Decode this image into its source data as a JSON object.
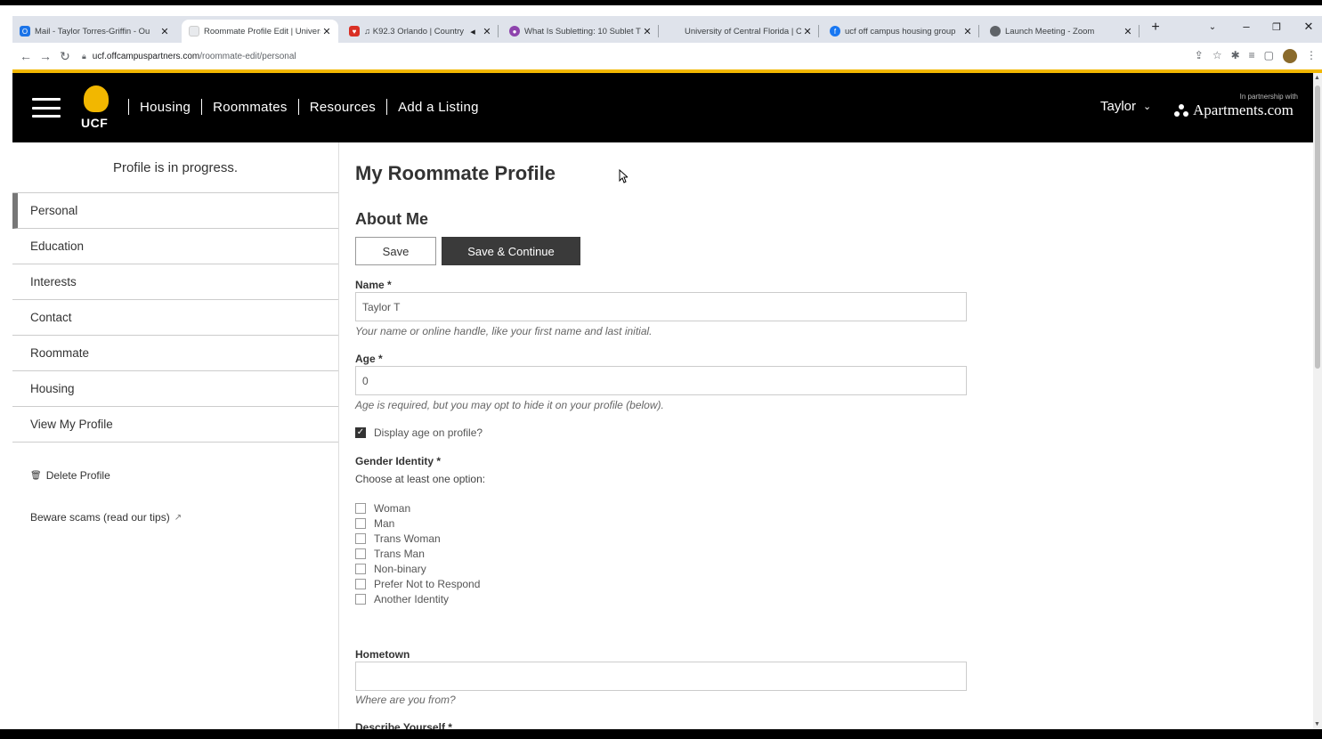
{
  "browser": {
    "tabs": [
      {
        "title": "Mail - Taylor Torres-Griffin - Ou",
        "active": false,
        "favicon_color": "#1a73e8"
      },
      {
        "title": "Roommate Profile Edit | Univers",
        "active": true,
        "favicon_color": "#cccccc"
      },
      {
        "title": "♫ K92.3 Orlando | Country",
        "active": false,
        "favicon_color": "#d93025"
      },
      {
        "title": "What Is Subletting: 10 Sublet T",
        "active": false,
        "favicon_color": "#8e44ad"
      },
      {
        "title": "University of Central Florida | C",
        "active": false,
        "favicon_color": "#dfe3eb"
      },
      {
        "title": "ucf off campus housing group",
        "active": false,
        "favicon_color": "#1877f2"
      },
      {
        "title": "Launch Meeting - Zoom",
        "active": false,
        "favicon_color": "#5f6368"
      }
    ],
    "new_tab_label": "+",
    "url_domain": "ucf.offcampuspartners.com",
    "url_path": "/roommate-edit/personal"
  },
  "header": {
    "logo_text": "UCF",
    "nav": [
      "Housing",
      "Roommates",
      "Resources",
      "Add a Listing"
    ],
    "user_name": "Taylor",
    "partner_small": "In partnership with",
    "partner_brand": "Apartments.com"
  },
  "sidebar": {
    "progress_text": "Profile is in progress.",
    "items": [
      "Personal",
      "Education",
      "Interests",
      "Contact",
      "Roommate",
      "Housing",
      "View My Profile"
    ],
    "delete_label": "Delete Profile",
    "scams_label": "Beware scams (read our tips)"
  },
  "main": {
    "title": "My Roommate Profile",
    "section": "About Me",
    "save_label": "Save",
    "save_continue_label": "Save & Continue",
    "name_label": "Name *",
    "name_value": "Taylor T",
    "name_help": "Your name or online handle, like your first name and last initial.",
    "age_label": "Age *",
    "age_value": "0",
    "age_help": "Age is required, but you may opt to hide it on your profile (below).",
    "display_age_label": "Display age on profile?",
    "display_age_checked": true,
    "gender_label": "Gender Identity *",
    "gender_hint": "Choose at least one option:",
    "gender_options": [
      "Woman",
      "Man",
      "Trans Woman",
      "Trans Man",
      "Non-binary",
      "Prefer Not to Respond",
      "Another Identity"
    ],
    "hometown_label": "Hometown",
    "hometown_value": "",
    "hometown_help": "Where are you from?",
    "describe_label": "Describe Yourself *"
  },
  "colors": {
    "accent_gold": "#f2b700",
    "header_bg": "#000000",
    "primary_button": "#3a3a3a"
  }
}
